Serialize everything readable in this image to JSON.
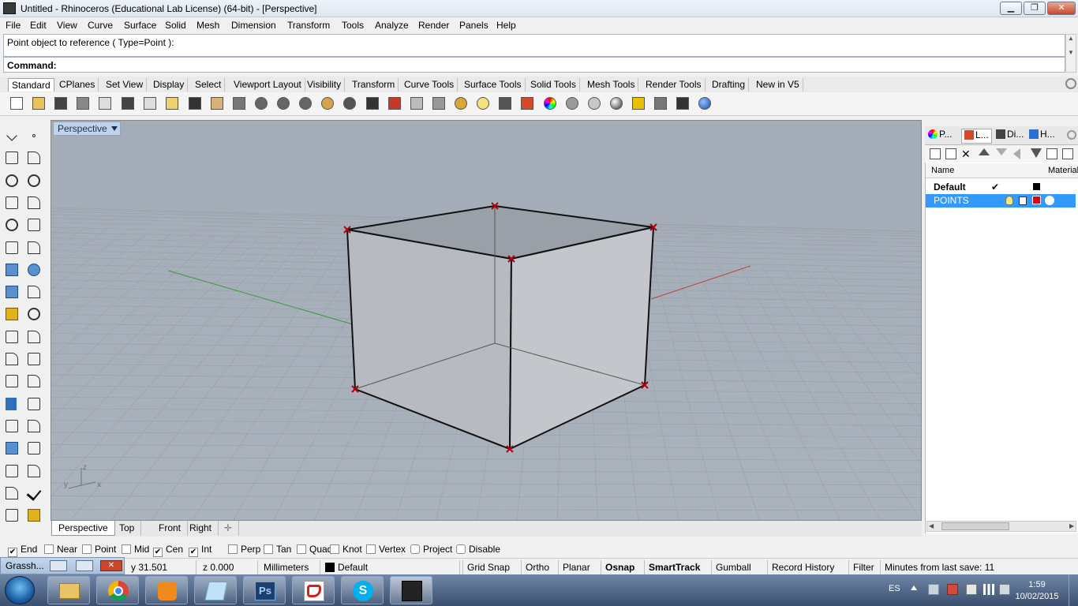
{
  "window": {
    "title": "Untitled - Rhinoceros (Educational Lab License) (64-bit) - [Perspective]"
  },
  "menu": [
    "File",
    "Edit",
    "View",
    "Curve",
    "Surface",
    "Solid",
    "Mesh",
    "Dimension",
    "Transform",
    "Tools",
    "Analyze",
    "Render",
    "Panels",
    "Help"
  ],
  "command": {
    "history": "Point object to reference ( Type=Point ):",
    "prompt": "Command:"
  },
  "toolbar_tabs": [
    "Standard",
    "CPlanes",
    "Set View",
    "Display",
    "Select",
    "Viewport Layout",
    "Visibility",
    "Transform",
    "Curve Tools",
    "Surface Tools",
    "Solid Tools",
    "Mesh Tools",
    "Render Tools",
    "Drafting",
    "New in V5"
  ],
  "viewport": {
    "label": "Perspective",
    "axis_labels": {
      "z": "z",
      "y": "y",
      "x": "x"
    },
    "colors": {
      "background": "#a6aeb8",
      "grid": "#98a0ab",
      "x_axis": "#b04a3a",
      "y_axis": "#3c9a3c"
    }
  },
  "view_tabs": [
    "Perspective",
    "Top",
    "Front",
    "Right"
  ],
  "panel": {
    "tabs": [
      "P...",
      "L...",
      "Di...",
      "H..."
    ],
    "columns": {
      "name": "Name",
      "material": "Material"
    },
    "layers": [
      {
        "name": "Default",
        "current": "✔",
        "color": "#000000"
      },
      {
        "name": "POINTS",
        "color": "#e0001a",
        "selected": true
      }
    ]
  },
  "osnaps": [
    {
      "label": "End",
      "checked": true
    },
    {
      "label": "Near",
      "checked": false
    },
    {
      "label": "Point",
      "checked": false
    },
    {
      "label": "Mid",
      "checked": false
    },
    {
      "label": "Cen",
      "checked": true
    },
    {
      "label": "Int",
      "checked": true
    },
    {
      "label": "Perp",
      "checked": false
    },
    {
      "label": "Tan",
      "checked": false
    },
    {
      "label": "Quad",
      "checked": false
    },
    {
      "label": "Knot",
      "checked": false
    },
    {
      "label": "Vertex",
      "checked": false
    },
    {
      "label": "Project",
      "checked": false
    },
    {
      "label": "Disable",
      "checked": false
    }
  ],
  "status": {
    "grasshopper": "Grassh...",
    "y": "y 31.501",
    "z": "z 0.000",
    "units": "Millimeters",
    "layer": "Default",
    "toggles": [
      "Grid Snap",
      "Ortho",
      "Planar",
      "Osnap",
      "SmartTrack",
      "Gumball",
      "Record History",
      "Filter"
    ],
    "bold_toggles": [
      "Osnap",
      "SmartTrack"
    ],
    "save_info": "Minutes from last save: 11"
  },
  "taskbar": {
    "lang": "ES",
    "time": "1:59",
    "date": "10/02/2015"
  }
}
